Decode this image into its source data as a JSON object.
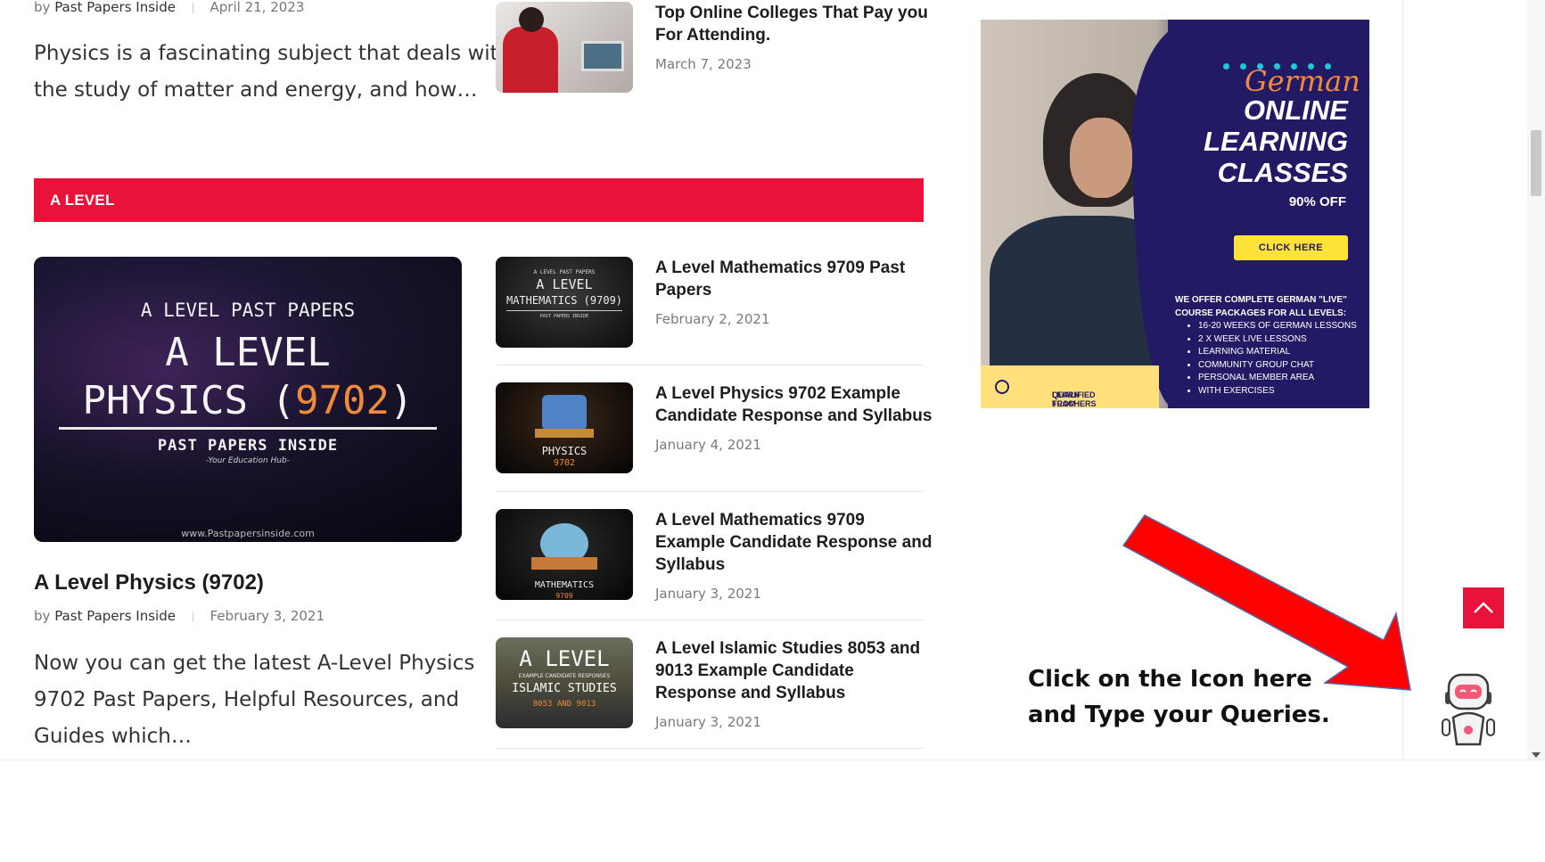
{
  "top_left": {
    "author_prefix": "by",
    "author": "Past Papers Inside",
    "date": "April 21, 2023",
    "excerpt_line1": "Physics is a fascinating subject that deals with",
    "excerpt_line2": "the study of matter and energy, and how…"
  },
  "top_right": {
    "title_line1": "Top Online Colleges That Pay you",
    "title_line2": "For Attending.",
    "date": "March 7, 2023"
  },
  "section": {
    "label": "A LEVEL"
  },
  "featured": {
    "thumb_text_top": "A LEVEL PAST PAPERS",
    "thumb_text_main1": "A LEVEL",
    "thumb_text_main2": "PHYSICS (",
    "thumb_text_code": "9702",
    "thumb_text_close": ")",
    "thumb_text_sub": "PAST PAPERS INSIDE",
    "thumb_text_tag": "-Your Education Hub-",
    "thumb_text_url": "www.Pastpapersinside.com",
    "title": "A Level Physics (9702)",
    "author_prefix": "by",
    "author": "Past Papers Inside",
    "date": "February 3, 2021",
    "excerpt_line1": "Now you can get the latest A-Level Physics",
    "excerpt_line2": "9702 Past Papers, Helpful Resources, and",
    "excerpt_line3": "Guides which…"
  },
  "posts": [
    {
      "title_line1": "A Level Mathematics 9709 Past",
      "title_line2": "Papers",
      "title_line3": "",
      "date": "February 2, 2021",
      "thumb_top": "A LEVEL PAST PAPERS",
      "thumb_main": "A LEVEL",
      "thumb_sub": "MATHEMATICS (9709)",
      "thumb_foot": "PAST PAPERS INSIDE"
    },
    {
      "title_line1": "A Level Physics 9702 Example",
      "title_line2": "Candidate Response and Syllabus",
      "title_line3": "",
      "date": "January 4, 2021",
      "thumb_main": "PHYSICS",
      "thumb_sub": "9702"
    },
    {
      "title_line1": "A Level Mathematics 9709",
      "title_line2": "Example Candidate Response and",
      "title_line3": "Syllabus",
      "date": "January 3, 2021",
      "thumb_main": "MATHEMATICS",
      "thumb_sub": "9709"
    },
    {
      "title_line1": "A Level Islamic Studies 8053 and",
      "title_line2": "9013 Example Candidate",
      "title_line3": "Response and Syllabus",
      "date": "January 3, 2021",
      "thumb_main": "A LEVEL",
      "thumb_top": "EXAMPLE CANDIDATE RESPONSES",
      "thumb_sub": "ISLAMIC STUDIES",
      "thumb_foot": "8053 AND 9013"
    }
  ],
  "ad": {
    "script_title": "German",
    "line1": "ONLINE",
    "line2": "LEARNING",
    "line3": "CLASSES",
    "discount": "90% OFF",
    "button": "CLICK HERE",
    "list_head1": "WE OFFER COMPLETE GERMAN \"LIVE\"",
    "list_head2": "COURSE PACKAGES FOR ALL LEVELS:",
    "items": [
      "16-20 WEEKS OF GERMAN LESSONS",
      "2 X WEEK LIVE LESSONS",
      "LEARNING MATERIAL",
      "COMMUNITY GROUP CHAT",
      "PERSONAL MEMBER AREA",
      "WITH EXERCISES"
    ],
    "bottom_line1": "LEARN FROM USA",
    "bottom_line2": "QUALIFIED TEACHERS"
  },
  "hint": {
    "line1": "Click on the Icon here",
    "line2": "and Type your Queries."
  },
  "colors": {
    "accent": "#e8123a",
    "arrow": "#ff0000",
    "ad_purple": "#231a66",
    "ad_yellow": "#ffe23a"
  },
  "icons": {
    "back_to_top": "chevron-up-icon",
    "chatbot": "robot-icon",
    "annotation": "red-arrow"
  }
}
